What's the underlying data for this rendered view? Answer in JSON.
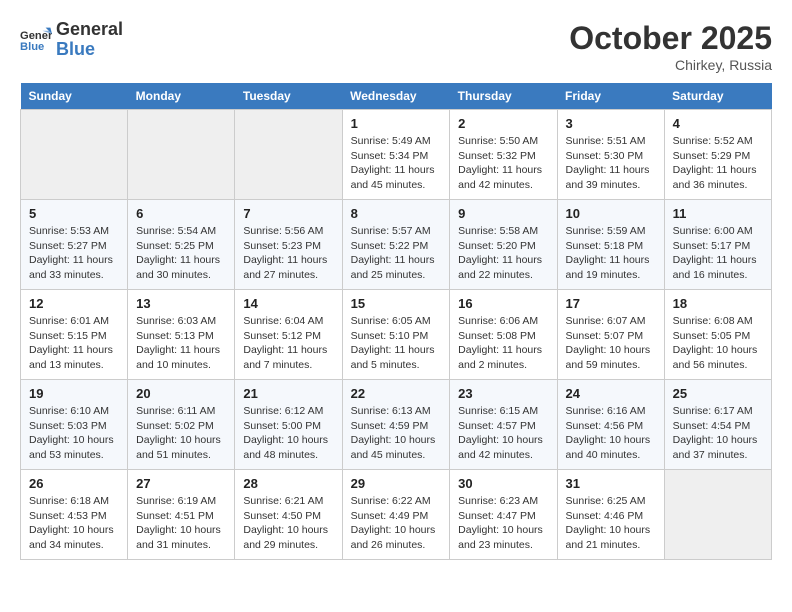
{
  "header": {
    "logo_line1": "General",
    "logo_line2": "Blue",
    "month": "October 2025",
    "location": "Chirkey, Russia"
  },
  "days_of_week": [
    "Sunday",
    "Monday",
    "Tuesday",
    "Wednesday",
    "Thursday",
    "Friday",
    "Saturday"
  ],
  "weeks": [
    [
      null,
      null,
      null,
      {
        "day": "1",
        "sunrise": "Sunrise: 5:49 AM",
        "sunset": "Sunset: 5:34 PM",
        "daylight": "Daylight: 11 hours and 45 minutes."
      },
      {
        "day": "2",
        "sunrise": "Sunrise: 5:50 AM",
        "sunset": "Sunset: 5:32 PM",
        "daylight": "Daylight: 11 hours and 42 minutes."
      },
      {
        "day": "3",
        "sunrise": "Sunrise: 5:51 AM",
        "sunset": "Sunset: 5:30 PM",
        "daylight": "Daylight: 11 hours and 39 minutes."
      },
      {
        "day": "4",
        "sunrise": "Sunrise: 5:52 AM",
        "sunset": "Sunset: 5:29 PM",
        "daylight": "Daylight: 11 hours and 36 minutes."
      }
    ],
    [
      {
        "day": "5",
        "sunrise": "Sunrise: 5:53 AM",
        "sunset": "Sunset: 5:27 PM",
        "daylight": "Daylight: 11 hours and 33 minutes."
      },
      {
        "day": "6",
        "sunrise": "Sunrise: 5:54 AM",
        "sunset": "Sunset: 5:25 PM",
        "daylight": "Daylight: 11 hours and 30 minutes."
      },
      {
        "day": "7",
        "sunrise": "Sunrise: 5:56 AM",
        "sunset": "Sunset: 5:23 PM",
        "daylight": "Daylight: 11 hours and 27 minutes."
      },
      {
        "day": "8",
        "sunrise": "Sunrise: 5:57 AM",
        "sunset": "Sunset: 5:22 PM",
        "daylight": "Daylight: 11 hours and 25 minutes."
      },
      {
        "day": "9",
        "sunrise": "Sunrise: 5:58 AM",
        "sunset": "Sunset: 5:20 PM",
        "daylight": "Daylight: 11 hours and 22 minutes."
      },
      {
        "day": "10",
        "sunrise": "Sunrise: 5:59 AM",
        "sunset": "Sunset: 5:18 PM",
        "daylight": "Daylight: 11 hours and 19 minutes."
      },
      {
        "day": "11",
        "sunrise": "Sunrise: 6:00 AM",
        "sunset": "Sunset: 5:17 PM",
        "daylight": "Daylight: 11 hours and 16 minutes."
      }
    ],
    [
      {
        "day": "12",
        "sunrise": "Sunrise: 6:01 AM",
        "sunset": "Sunset: 5:15 PM",
        "daylight": "Daylight: 11 hours and 13 minutes."
      },
      {
        "day": "13",
        "sunrise": "Sunrise: 6:03 AM",
        "sunset": "Sunset: 5:13 PM",
        "daylight": "Daylight: 11 hours and 10 minutes."
      },
      {
        "day": "14",
        "sunrise": "Sunrise: 6:04 AM",
        "sunset": "Sunset: 5:12 PM",
        "daylight": "Daylight: 11 hours and 7 minutes."
      },
      {
        "day": "15",
        "sunrise": "Sunrise: 6:05 AM",
        "sunset": "Sunset: 5:10 PM",
        "daylight": "Daylight: 11 hours and 5 minutes."
      },
      {
        "day": "16",
        "sunrise": "Sunrise: 6:06 AM",
        "sunset": "Sunset: 5:08 PM",
        "daylight": "Daylight: 11 hours and 2 minutes."
      },
      {
        "day": "17",
        "sunrise": "Sunrise: 6:07 AM",
        "sunset": "Sunset: 5:07 PM",
        "daylight": "Daylight: 10 hours and 59 minutes."
      },
      {
        "day": "18",
        "sunrise": "Sunrise: 6:08 AM",
        "sunset": "Sunset: 5:05 PM",
        "daylight": "Daylight: 10 hours and 56 minutes."
      }
    ],
    [
      {
        "day": "19",
        "sunrise": "Sunrise: 6:10 AM",
        "sunset": "Sunset: 5:03 PM",
        "daylight": "Daylight: 10 hours and 53 minutes."
      },
      {
        "day": "20",
        "sunrise": "Sunrise: 6:11 AM",
        "sunset": "Sunset: 5:02 PM",
        "daylight": "Daylight: 10 hours and 51 minutes."
      },
      {
        "day": "21",
        "sunrise": "Sunrise: 6:12 AM",
        "sunset": "Sunset: 5:00 PM",
        "daylight": "Daylight: 10 hours and 48 minutes."
      },
      {
        "day": "22",
        "sunrise": "Sunrise: 6:13 AM",
        "sunset": "Sunset: 4:59 PM",
        "daylight": "Daylight: 10 hours and 45 minutes."
      },
      {
        "day": "23",
        "sunrise": "Sunrise: 6:15 AM",
        "sunset": "Sunset: 4:57 PM",
        "daylight": "Daylight: 10 hours and 42 minutes."
      },
      {
        "day": "24",
        "sunrise": "Sunrise: 6:16 AM",
        "sunset": "Sunset: 4:56 PM",
        "daylight": "Daylight: 10 hours and 40 minutes."
      },
      {
        "day": "25",
        "sunrise": "Sunrise: 6:17 AM",
        "sunset": "Sunset: 4:54 PM",
        "daylight": "Daylight: 10 hours and 37 minutes."
      }
    ],
    [
      {
        "day": "26",
        "sunrise": "Sunrise: 6:18 AM",
        "sunset": "Sunset: 4:53 PM",
        "daylight": "Daylight: 10 hours and 34 minutes."
      },
      {
        "day": "27",
        "sunrise": "Sunrise: 6:19 AM",
        "sunset": "Sunset: 4:51 PM",
        "daylight": "Daylight: 10 hours and 31 minutes."
      },
      {
        "day": "28",
        "sunrise": "Sunrise: 6:21 AM",
        "sunset": "Sunset: 4:50 PM",
        "daylight": "Daylight: 10 hours and 29 minutes."
      },
      {
        "day": "29",
        "sunrise": "Sunrise: 6:22 AM",
        "sunset": "Sunset: 4:49 PM",
        "daylight": "Daylight: 10 hours and 26 minutes."
      },
      {
        "day": "30",
        "sunrise": "Sunrise: 6:23 AM",
        "sunset": "Sunset: 4:47 PM",
        "daylight": "Daylight: 10 hours and 23 minutes."
      },
      {
        "day": "31",
        "sunrise": "Sunrise: 6:25 AM",
        "sunset": "Sunset: 4:46 PM",
        "daylight": "Daylight: 10 hours and 21 minutes."
      },
      null
    ]
  ]
}
